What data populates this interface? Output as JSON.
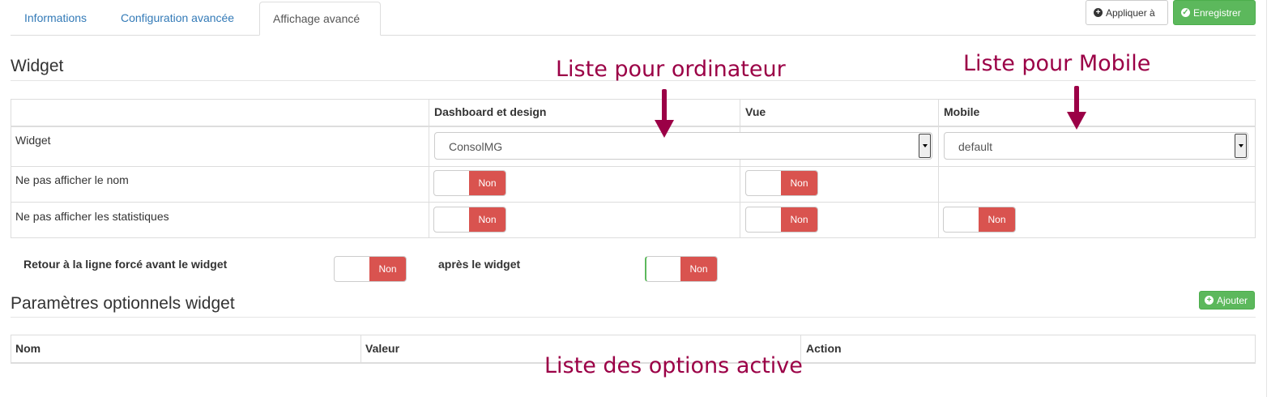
{
  "tabs": [
    {
      "label": "Informations"
    },
    {
      "label": "Configuration avancée"
    },
    {
      "label": "Affichage avancé"
    }
  ],
  "toolbar": {
    "apply_label": "Appliquer à",
    "save_label": "Enregistrer"
  },
  "widget_section": {
    "title": "Widget",
    "columns": [
      "",
      "Dashboard et design",
      "Vue",
      "Mobile"
    ],
    "rows": [
      {
        "label": "Widget",
        "dashboard_select": "ConsolMG",
        "mobile_select": "default"
      },
      {
        "label": "Ne pas afficher le nom",
        "dashboard": "Non",
        "vue": "Non"
      },
      {
        "label": "Ne pas afficher les statistiques",
        "dashboard": "Non",
        "vue": "Non",
        "mobile": "Non"
      }
    ],
    "linebreak_before_label": "Retour à la ligne forcé avant le widget",
    "linebreak_before_value": "Non",
    "linebreak_after_label": "après le widget",
    "linebreak_after_value": "Non"
  },
  "params_section": {
    "title": "Paramètres optionnels widget",
    "add_label": "Ajouter",
    "columns": [
      "Nom",
      "Valeur",
      "Action"
    ]
  },
  "annotations": {
    "desktop": "Liste pour ordinateur",
    "mobile": "Liste pour Mobile",
    "options": "Liste des options active"
  },
  "colors": {
    "annotation": "#9b0046",
    "toggle_off": "#d9534f",
    "success": "#5cb85c",
    "link": "#337ab7"
  }
}
